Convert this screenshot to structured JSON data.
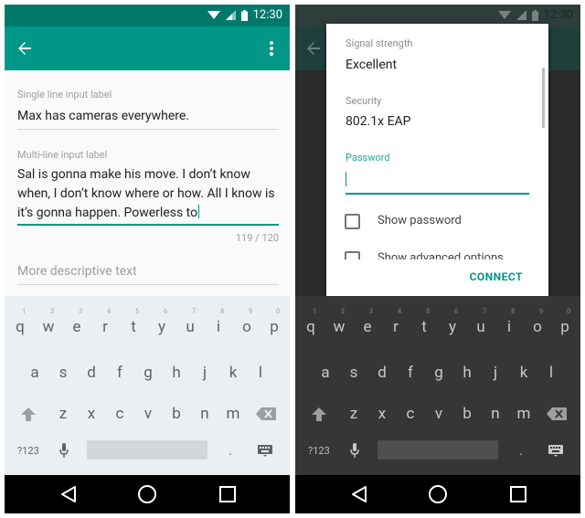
{
  "status_bar": {
    "time": "12:30"
  },
  "form": {
    "single_line": {
      "label": "Single line input label",
      "value": "Max has cameras everywhere."
    },
    "multi_line": {
      "label": "Multi-line input label",
      "lines": [
        "Sal is gonna make his move. I don’t know",
        "when, I don’t know where or how. All I know is",
        "it’s gonna happen. Powerless to"
      ],
      "counter": "119 / 120"
    },
    "descriptive": {
      "placeholder": "More descriptive text"
    }
  },
  "keyboard": {
    "row1": [
      "q",
      "w",
      "e",
      "r",
      "t",
      "y",
      "u",
      "i",
      "o",
      "p"
    ],
    "row1_hints": [
      "1",
      "2",
      "3",
      "4",
      "5",
      "6",
      "7",
      "8",
      "9",
      "0"
    ],
    "row2": [
      "a",
      "s",
      "d",
      "f",
      "g",
      "h",
      "j",
      "k",
      "l"
    ],
    "row3": [
      "z",
      "x",
      "c",
      "v",
      "b",
      "n",
      "m"
    ],
    "symbols_label": "?123",
    "period": "."
  },
  "dialog": {
    "signal_label": "Signal strength",
    "signal_value": "Excellent",
    "security_label": "Security",
    "security_value": "802.1x EAP",
    "password_label": "Password",
    "show_password": "Show password",
    "advanced": "Show advanced options",
    "connect": "CONNECT"
  },
  "colors": {
    "primary": "#009688",
    "primary_dark": "#00796b",
    "keyboard_light": "#eceff1",
    "keyboard_dark": "#363636"
  },
  "icons": {
    "back": "arrow-back-icon",
    "overflow": "more-vert-icon",
    "wifi": "wifi-icon",
    "signal": "signal-icon",
    "battery": "battery-icon",
    "shift": "shift-icon",
    "backspace": "backspace-icon",
    "mic": "mic-icon",
    "emoji_keyboard": "keyboard-icon",
    "nav_back": "triangle-back-icon",
    "nav_home": "circle-home-icon",
    "nav_recents": "square-recents-icon"
  }
}
